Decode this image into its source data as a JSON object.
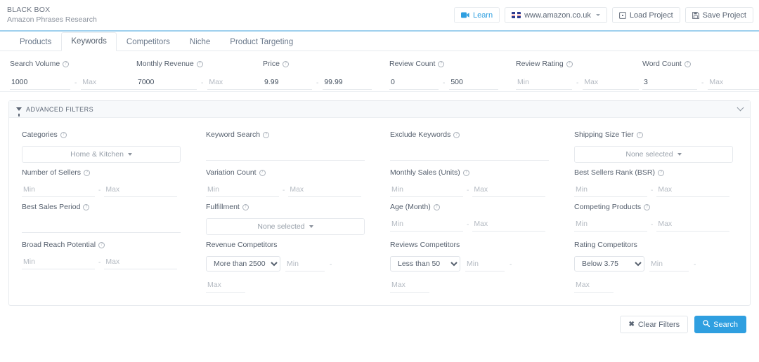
{
  "header": {
    "brand_title": "BLACK BOX",
    "brand_subtitle": "Amazon Phrases Research",
    "learn_label": "Learn",
    "marketplace_label": "www.amazon.co.uk",
    "load_project_label": "Load Project",
    "save_project_label": "Save Project",
    "accent_color": "#2f9fe0",
    "underline_color": "#9fd0ee"
  },
  "tabs": [
    {
      "label": "Products",
      "active": false
    },
    {
      "label": "Keywords",
      "active": true
    },
    {
      "label": "Competitors",
      "active": false
    },
    {
      "label": "Niche",
      "active": false
    },
    {
      "label": "Product Targeting",
      "active": false
    }
  ],
  "quick_filters": [
    {
      "label": "Search Volume",
      "help": true,
      "min_value": "1000",
      "min_placeholder": "Min",
      "max_value": "",
      "max_placeholder": "Max"
    },
    {
      "label": "Monthly Revenue",
      "help": true,
      "min_value": "7000",
      "min_placeholder": "Min",
      "max_value": "",
      "max_placeholder": "Max"
    },
    {
      "label": "Price",
      "help": true,
      "min_value": "9.99",
      "min_placeholder": "Min",
      "max_value": "99.99",
      "max_placeholder": "Max"
    },
    {
      "label": "Review Count",
      "help": true,
      "min_value": "0",
      "min_placeholder": "Min",
      "max_value": "500",
      "max_placeholder": "Max"
    },
    {
      "label": "Review Rating",
      "help": true,
      "min_value": "",
      "min_placeholder": "Min",
      "max_value": "",
      "max_placeholder": "Max"
    },
    {
      "label": "Word Count",
      "help": true,
      "min_value": "3",
      "min_placeholder": "Min",
      "max_value": "",
      "max_placeholder": "Max"
    }
  ],
  "advanced": {
    "title": "ADVANCED FILTERS",
    "collapse_state": "expanded",
    "row1": [
      {
        "label": "Categories",
        "help": true,
        "type": "boxselect",
        "value": "Home & Kitchen"
      },
      {
        "label": "Keyword Search",
        "help": true,
        "type": "text",
        "value": "",
        "placeholder": ""
      },
      {
        "label": "Exclude Keywords",
        "help": true,
        "type": "text",
        "value": "",
        "placeholder": ""
      },
      {
        "label": "Shipping Size Tier",
        "help": true,
        "type": "boxselect",
        "value": "None selected"
      }
    ],
    "row2": [
      {
        "label": "Number of Sellers",
        "help": true,
        "type": "minmax",
        "min_value": "",
        "min_placeholder": "Min",
        "max_value": "",
        "max_placeholder": "Max"
      },
      {
        "label": "Variation Count",
        "help": true,
        "type": "minmax",
        "min_value": "",
        "min_placeholder": "Min",
        "max_value": "",
        "max_placeholder": "Max"
      },
      {
        "label": "Monthly Sales (Units)",
        "help": true,
        "type": "minmax",
        "min_value": "",
        "min_placeholder": "Min",
        "max_value": "",
        "max_placeholder": "Max"
      },
      {
        "label": "Best Sellers Rank (BSR)",
        "help": true,
        "type": "minmax",
        "min_value": "",
        "min_placeholder": "Min",
        "max_value": "",
        "max_placeholder": "Max"
      }
    ],
    "row3": [
      {
        "label": "Best Sales Period",
        "help": true,
        "type": "text",
        "value": "",
        "placeholder": ""
      },
      {
        "label": "Fulfillment",
        "help": true,
        "type": "boxselect",
        "value": "None selected"
      },
      {
        "label": "Age (Month)",
        "help": true,
        "type": "minmax",
        "min_value": "",
        "min_placeholder": "Min",
        "max_value": "",
        "max_placeholder": "Max"
      },
      {
        "label": "Competing Products",
        "help": true,
        "type": "minmax",
        "min_value": "",
        "min_placeholder": "Min",
        "max_value": "",
        "max_placeholder": "Max"
      }
    ],
    "row4": [
      {
        "label": "Broad Reach Potential",
        "help": true,
        "type": "minmax",
        "min_value": "",
        "min_placeholder": "Min",
        "max_value": "",
        "max_placeholder": "Max"
      },
      {
        "label": "Revenue Competitors",
        "help": false,
        "type": "competitor",
        "select_value": "More than 2500",
        "select_options": [
          "More than 2500"
        ],
        "min_value": "",
        "min_placeholder": "Min",
        "max_value": "",
        "max_placeholder": "Max"
      },
      {
        "label": "Reviews Competitors",
        "help": false,
        "type": "competitor",
        "select_value": "Less than 50",
        "select_options": [
          "Less than 50"
        ],
        "min_value": "",
        "min_placeholder": "Min",
        "max_value": "",
        "max_placeholder": "Max"
      },
      {
        "label": "Rating Competitors",
        "help": false,
        "type": "competitor",
        "select_value": "Below 3.75",
        "select_options": [
          "Below 3.75"
        ],
        "min_value": "",
        "min_placeholder": "Min",
        "max_value": "",
        "max_placeholder": "Max"
      }
    ]
  },
  "footer": {
    "clear_label": "Clear Filters",
    "search_label": "Search"
  }
}
